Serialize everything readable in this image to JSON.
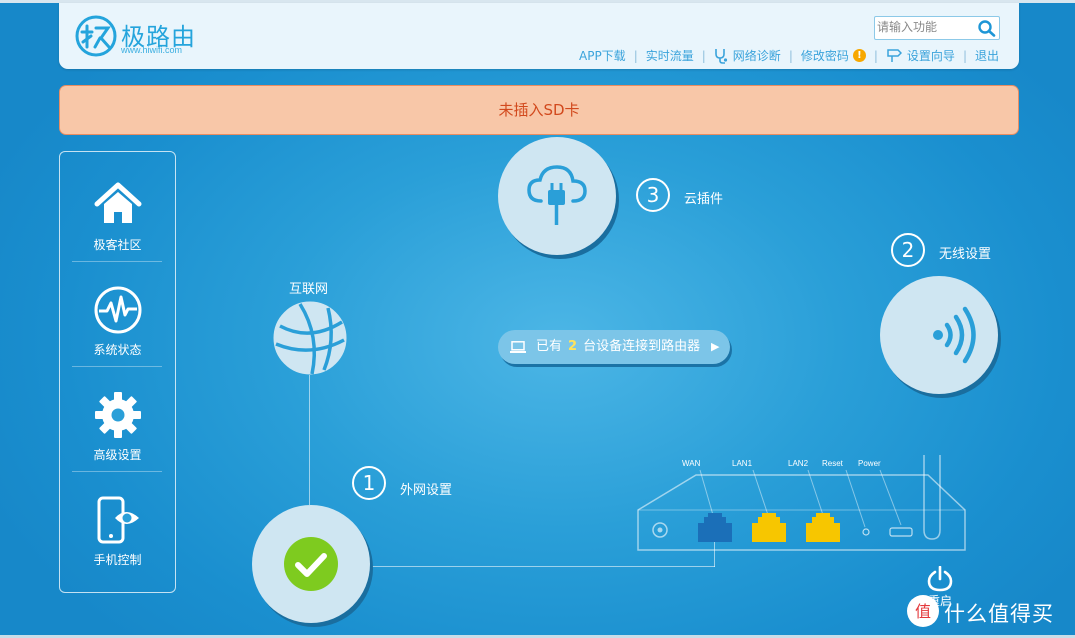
{
  "header": {
    "logo_text": "极路由",
    "logo_sub": "www.hiwifi.com",
    "search_placeholder": "请输入功能",
    "links": [
      "APP下载",
      "实时流量",
      "网络诊断",
      "修改密码",
      "设置向导",
      "退出"
    ],
    "warn_mark": "!"
  },
  "alert": {
    "text": "未插入SD卡"
  },
  "sidebar": {
    "items": [
      {
        "label": "极客社区",
        "icon": "home-icon"
      },
      {
        "label": "系统状态",
        "icon": "pulse-icon"
      },
      {
        "label": "高级设置",
        "icon": "gear-icon"
      },
      {
        "label": "手机控制",
        "icon": "phone-icon"
      }
    ]
  },
  "main": {
    "internet_label": "互联网",
    "steps": [
      {
        "num": "1",
        "label": "外网设置"
      },
      {
        "num": "2",
        "label": "无线设置"
      },
      {
        "num": "3",
        "label": "云插件"
      }
    ],
    "devices": {
      "prefix": "已有",
      "count": "2",
      "suffix": "台设备连接到路由器",
      "arrow": "▶"
    },
    "ports": [
      "WAN",
      "LAN1",
      "LAN2",
      "Reset",
      "Power"
    ],
    "reboot_label": "重启"
  },
  "watermark": {
    "text": "什么值得买",
    "mark": "值"
  },
  "colors": {
    "accent": "#24a4dc",
    "alert_bg": "#f8c7a8",
    "alert_text": "#d2491d",
    "ok_green": "#7ecb1f",
    "port_yellow": "#f7c600",
    "port_blue": "#1b6fb8"
  }
}
